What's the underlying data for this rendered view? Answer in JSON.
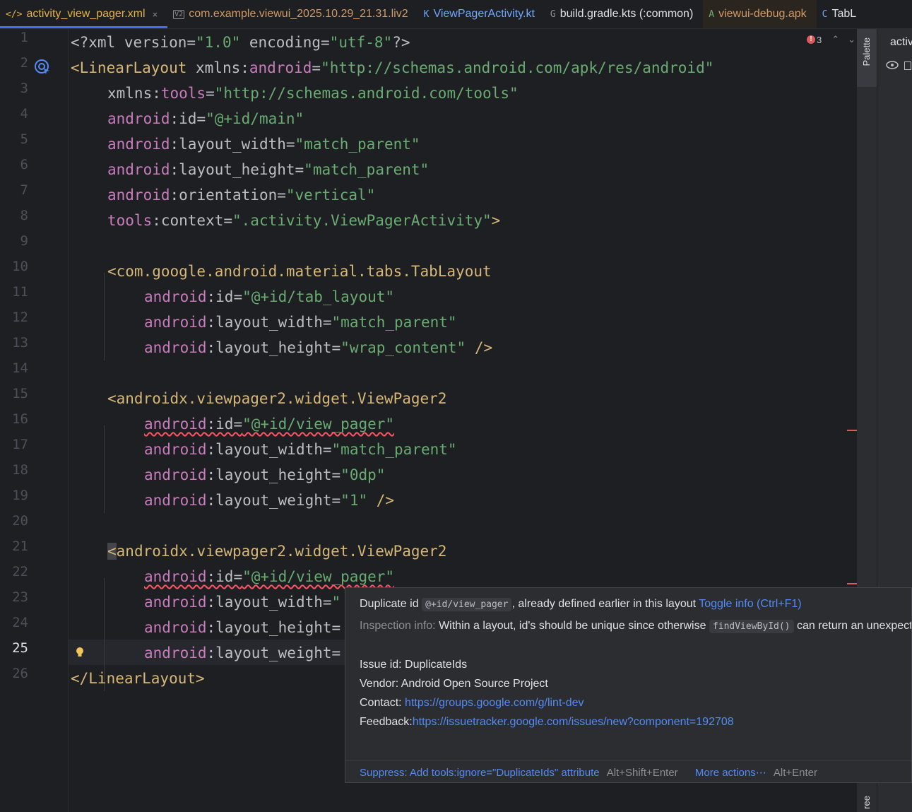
{
  "tabs": [
    {
      "icon": "</>",
      "label": "activity_view_pager.xml",
      "close": "×"
    },
    {
      "icon": "V2",
      "label": "com.example.viewui_2025.10.29_21.31.liv2"
    },
    {
      "icon": "K",
      "label": "ViewPagerActivity.kt"
    },
    {
      "icon": "G",
      "label": "build.gradle.kts (:common)"
    },
    {
      "icon": "A",
      "label": "viewui-debug.apk"
    },
    {
      "icon": "C",
      "label": "TabL"
    }
  ],
  "editor": {
    "problems_count": "3",
    "line_numbers": [
      "1",
      "2",
      "3",
      "4",
      "5",
      "6",
      "7",
      "8",
      "9",
      "10",
      "11",
      "12",
      "13",
      "14",
      "15",
      "16",
      "17",
      "18",
      "19",
      "20",
      "21",
      "22",
      "23",
      "24",
      "25",
      "26"
    ],
    "current_line": "25",
    "lines": {
      "l1": {
        "a": "<?xml version=",
        "b": "\"1.0\"",
        "c": " encoding=",
        "d": "\"utf-8\"",
        "e": "?>"
      },
      "l2": {
        "a": "<LinearLayout",
        "b": " xmlns:",
        "c": "android",
        "d": "=",
        "e": "\"http://schemas.android.com/apk/res/android\""
      },
      "l3": {
        "a": "xmlns:",
        "b": "tools",
        "c": "=",
        "d": "\"http://schemas.android.com/tools\""
      },
      "l4": {
        "a": "android",
        "b": ":id=",
        "c": "\"@+id/main\""
      },
      "l5": {
        "a": "android",
        "b": ":layout_width=",
        "c": "\"match_parent\""
      },
      "l6": {
        "a": "android",
        "b": ":layout_height=",
        "c": "\"match_parent\""
      },
      "l7": {
        "a": "android",
        "b": ":orientation=",
        "c": "\"vertical\""
      },
      "l8": {
        "a": "tools",
        "b": ":context=",
        "c": "\".activity.ViewPagerActivity\"",
        "d": ">"
      },
      "l10": {
        "a": "<com.google.android.material.tabs.TabLayout"
      },
      "l11": {
        "a": "android",
        "b": ":id=",
        "c": "\"@+id/tab_layout\""
      },
      "l12": {
        "a": "android",
        "b": ":layout_width=",
        "c": "\"match_parent\""
      },
      "l13": {
        "a": "android",
        "b": ":layout_height=",
        "c": "\"wrap_content\"",
        "d": " />"
      },
      "l15": {
        "a": "<androidx.viewpager2.widget.ViewPager2"
      },
      "l16": {
        "a": "android",
        "b": ":id=",
        "c": "\"@+id/view_pager\""
      },
      "l17": {
        "a": "android",
        "b": ":layout_width=",
        "c": "\"match_parent\""
      },
      "l18": {
        "a": "android",
        "b": ":layout_height=",
        "c": "\"0dp\""
      },
      "l19": {
        "a": "android",
        "b": ":layout_weight=",
        "c": "\"1\"",
        "d": " />"
      },
      "l21": {
        "a": "<",
        "b": "androidx.viewpager2.widget.ViewPager2"
      },
      "l22": {
        "a": "android",
        "b": ":id=",
        "c": "\"@+id/view_pager\""
      },
      "l23": {
        "a": "android",
        "b": ":layout_width=",
        "c": "\""
      },
      "l24": {
        "a": "android",
        "b": ":layout_height="
      },
      "l25": {
        "a": "android",
        "b": ":layout_weight="
      },
      "l26": {
        "a": "</LinearLayout>"
      }
    }
  },
  "side_panel": {
    "palette_label": "Palette",
    "preview_label": "activ",
    "bottom_label": "ree"
  },
  "popup": {
    "title_prefix": "Duplicate id",
    "title_code": "@+id/view_pager",
    "title_suffix": ", already defined earlier in this layout",
    "toggle_link": "Toggle info (Ctrl+F1)",
    "info_label": "Inspection info:",
    "info_text": "Within a layout, id's should be unique since otherwise",
    "info_code": "findViewById()",
    "info_tail": "can return an unexpected",
    "issue_id": "Issue id: DuplicateIds",
    "vendor": "Vendor: Android Open Source Project",
    "contact_label": "Contact:",
    "contact_link": "https://groups.google.com/g/lint-dev",
    "feedback_label": "Feedback:",
    "feedback_link": "https://issuetracker.google.com/issues/new?component=192708",
    "suppress_action": "Suppress: Add tools:ignore=\"DuplicateIds\" attribute",
    "suppress_shortcut": "Alt+Shift+Enter",
    "more_actions": "More actions⋯",
    "more_shortcut": "Alt+Enter"
  }
}
